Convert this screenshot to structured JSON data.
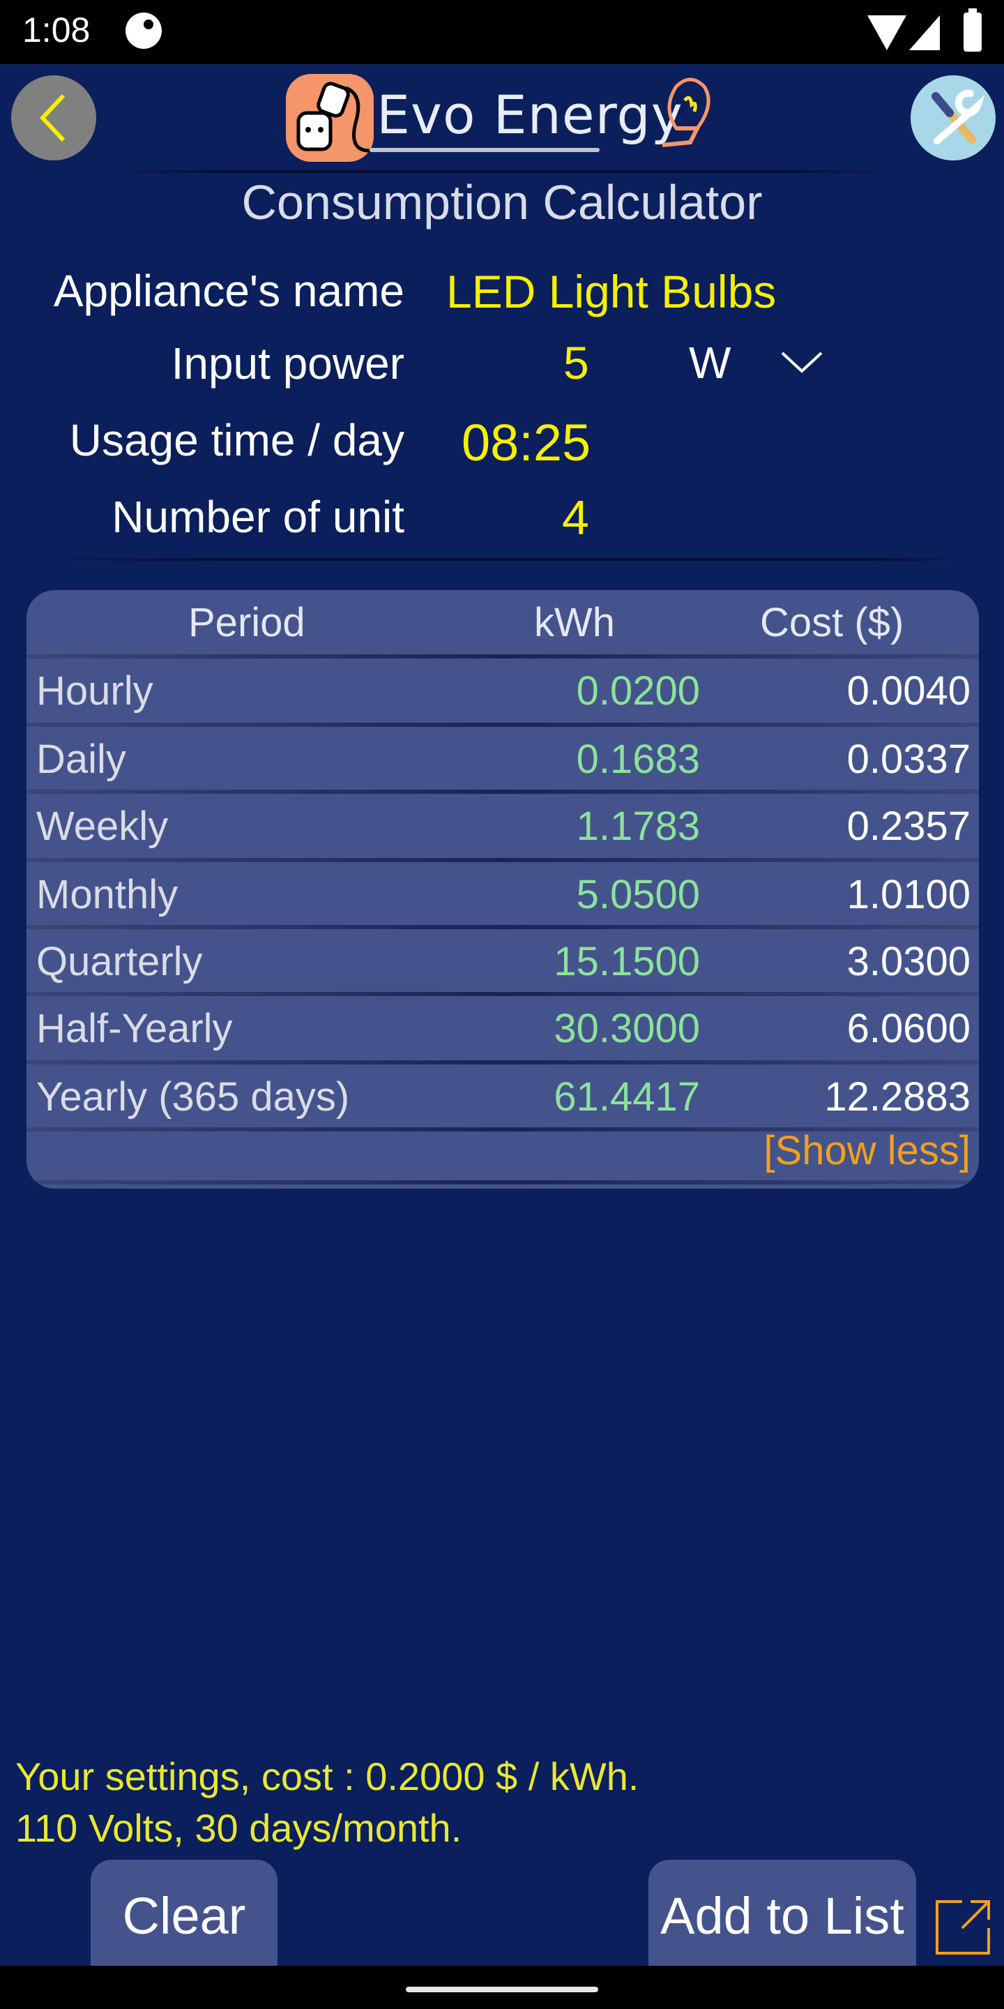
{
  "status_bar": {
    "time": "1:08",
    "icons": [
      "notification-icon",
      "wifi-icon",
      "signal-icon",
      "battery-icon"
    ]
  },
  "header": {
    "back_icon": "chevron-left-icon",
    "logo_text": "Evo Energy",
    "settings_icon": "tools-icon"
  },
  "page_title": "Consumption Calculator",
  "form": {
    "appliance_name_label": "Appliance's name",
    "appliance_name_value": "LED Light Bulbs",
    "input_power_label": "Input power",
    "input_power_value": "5",
    "input_power_unit": "W",
    "usage_time_label": "Usage time / day",
    "usage_time_value": "08:25",
    "units_label": "Number of unit",
    "units_value": "4"
  },
  "table": {
    "headers": [
      "Period",
      "kWh",
      "Cost ($)"
    ],
    "rows": [
      {
        "period": "Hourly",
        "kwh": "0.0200",
        "cost": "0.0040"
      },
      {
        "period": "Daily",
        "kwh": "0.1683",
        "cost": "0.0337"
      },
      {
        "period": "Weekly",
        "kwh": "1.1783",
        "cost": "0.2357"
      },
      {
        "period": "Monthly",
        "kwh": "5.0500",
        "cost": "1.0100"
      },
      {
        "period": "Quarterly",
        "kwh": "15.1500",
        "cost": "3.0300"
      },
      {
        "period": "Half-Yearly",
        "kwh": "30.3000",
        "cost": "6.0600"
      },
      {
        "period": "Yearly (365 days)",
        "kwh": "61.4417",
        "cost": "12.2883"
      }
    ],
    "show_less_label": "[Show less]"
  },
  "settings_summary": {
    "line1": "Your settings, cost : 0.2000 $ / kWh.",
    "line2": "110 Volts, 30 days/month."
  },
  "buttons": {
    "clear_label": "Clear",
    "add_label": "Add to List",
    "export_icon": "external-link-icon"
  },
  "colors": {
    "background": "#0b1f5c",
    "card": "#45538c",
    "value_yellow": "#f6f000",
    "kwh_green": "#8be39a",
    "accent_orange": "#f0a020"
  }
}
